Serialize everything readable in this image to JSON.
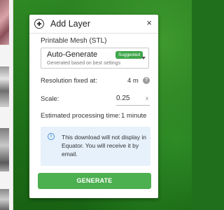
{
  "dialog": {
    "title": "Add Layer",
    "close_glyph": "×",
    "add_icon": "add-circle-icon",
    "section_label": "Printable Mesh (STL)",
    "select": {
      "value": "Auto-Generate",
      "badge": "Suggested",
      "helper": "Generated based on best settings",
      "caret_icon": "caret-down-icon"
    },
    "resolution": {
      "label": "Resolution fixed at:",
      "value": "4 m",
      "help_glyph": "?"
    },
    "scale": {
      "label": "Scale:",
      "value": "0.25",
      "unit": "x"
    },
    "processing": {
      "label": "Estimated processing time:",
      "value": "1 minute"
    },
    "info": {
      "icon_glyph": "i",
      "text": "This download will not display in Equator. You will receive it by email."
    },
    "generate_label": "GENERATE"
  },
  "colors": {
    "accent_green": "#4caf50",
    "badge_green": "#3fa64a",
    "info_bg": "#e6f1fb",
    "info_blue": "#4a90d9"
  }
}
